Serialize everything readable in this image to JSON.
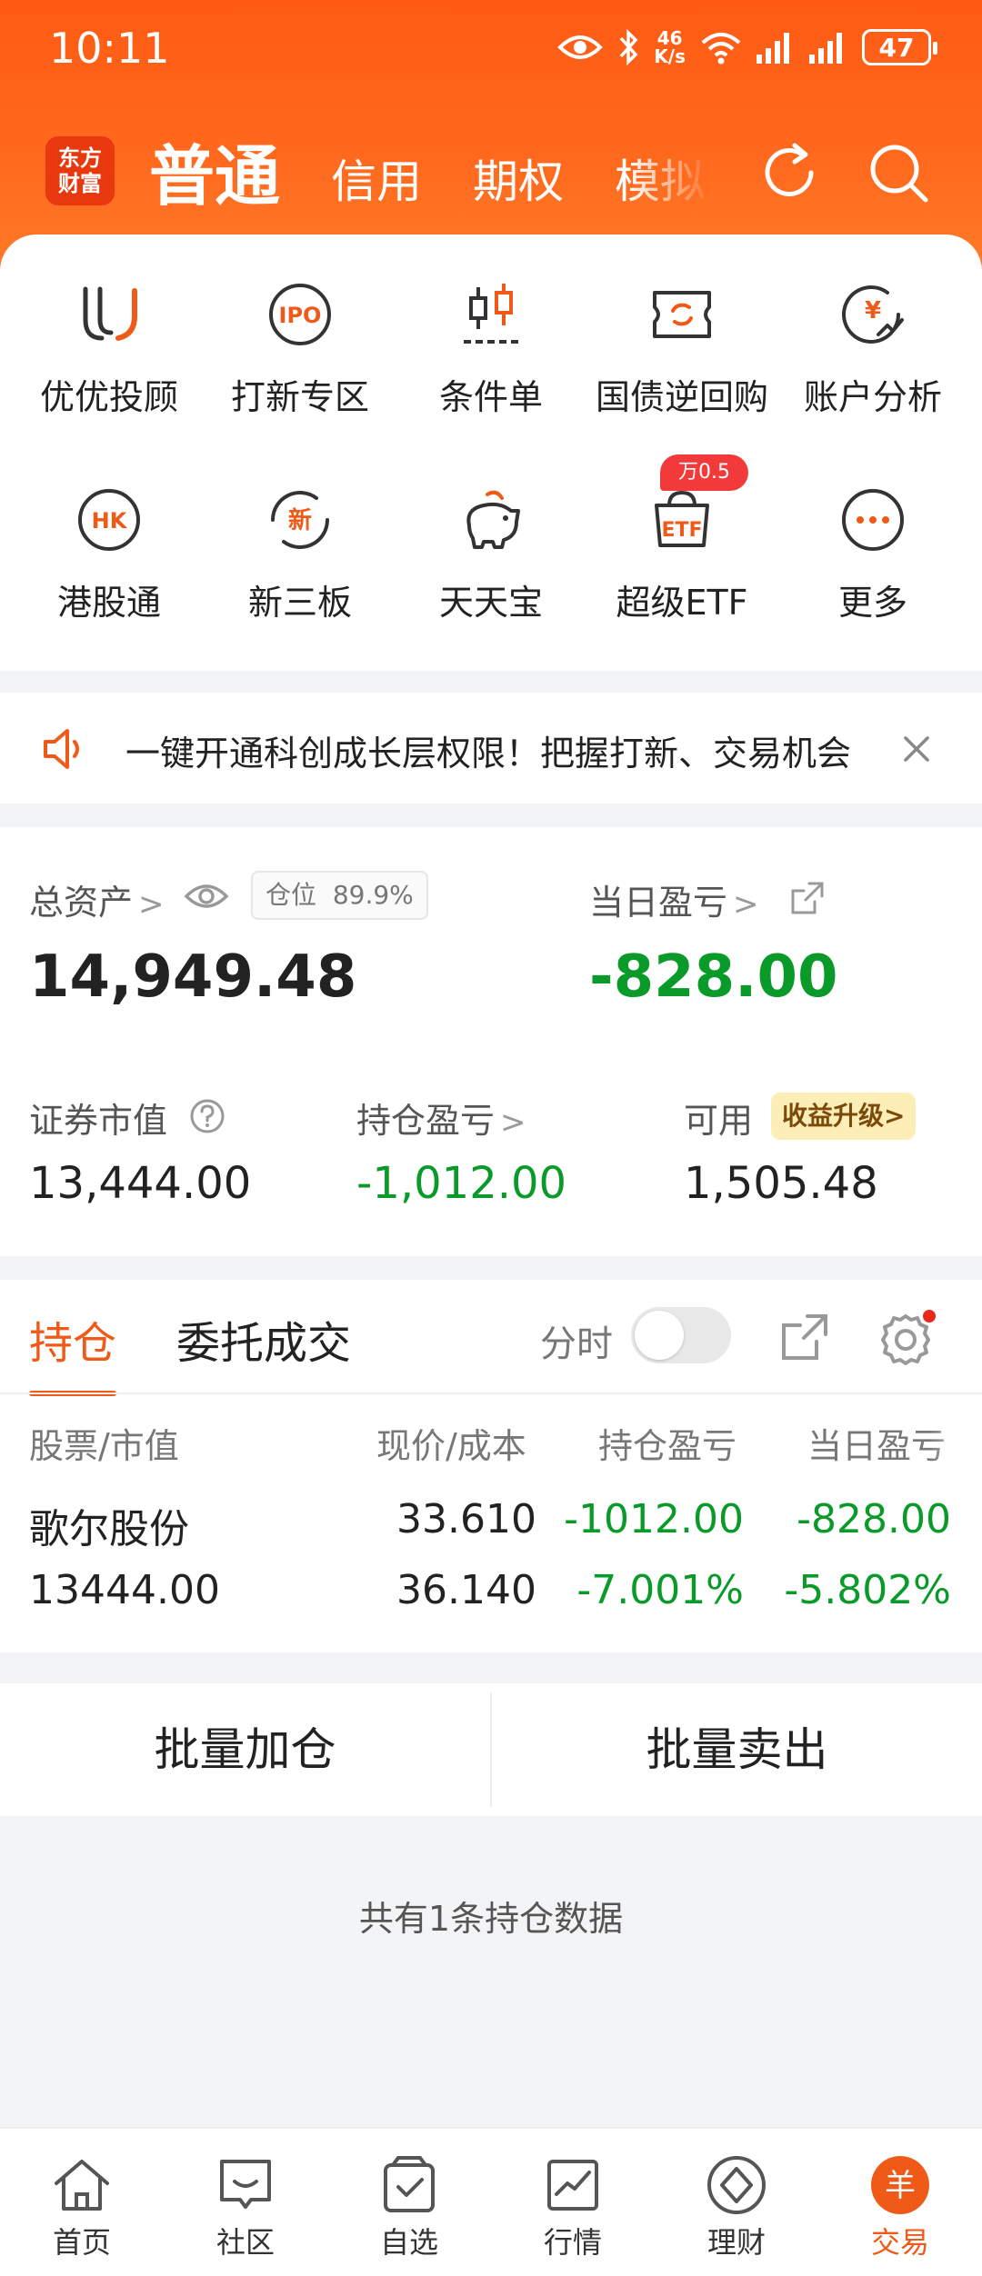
{
  "status_bar": {
    "time": "10:11",
    "net_speed_value": "46",
    "net_speed_unit": "K/s",
    "battery": "47"
  },
  "header": {
    "logo_line1": "东方",
    "logo_line2": "财富",
    "tabs": [
      {
        "label": "普通",
        "active": true
      },
      {
        "label": "信用",
        "active": false
      },
      {
        "label": "期权",
        "active": false
      },
      {
        "label": "模拟",
        "active": false
      }
    ]
  },
  "grid": {
    "items": [
      {
        "label": "优优投顾",
        "icon": "uu-advisor-icon"
      },
      {
        "label": "打新专区",
        "icon": "ipo-icon"
      },
      {
        "label": "条件单",
        "icon": "candlestick-icon"
      },
      {
        "label": "国债逆回购",
        "icon": "treasury-repo-icon"
      },
      {
        "label": "账户分析",
        "icon": "account-analysis-icon"
      },
      {
        "label": "港股通",
        "icon": "hk-icon"
      },
      {
        "label": "新三板",
        "icon": "neeq-icon"
      },
      {
        "label": "天天宝",
        "icon": "piggy-bank-icon"
      },
      {
        "label": "超级ETF",
        "icon": "etf-icon"
      },
      {
        "label": "更多",
        "icon": "more-icon"
      }
    ],
    "etf_badge": "万0.5"
  },
  "notice": {
    "text": "一键开通科创成长层权限！把握打新、交易机会"
  },
  "assets": {
    "total_label": "总资产",
    "position_label": "仓位",
    "position_value": "89.9%",
    "total_value": "14,949.48",
    "daily_pl_label": "当日盈亏",
    "daily_pl_value": "-828.00",
    "market_value_label": "证券市值",
    "market_value": "13,444.00",
    "holding_pl_label": "持仓盈亏",
    "holding_pl_value": "-1,012.00",
    "available_label": "可用",
    "available_value": "1,505.48",
    "upgrade_label": "收益升级>"
  },
  "holdings": {
    "tab_positions": "持仓",
    "tab_orders": "委托成交",
    "intraday_label": "分时",
    "columns": [
      "股票/市值",
      "现价/成本",
      "持仓盈亏",
      "当日盈亏"
    ],
    "rows": [
      {
        "name": "歌尔股份",
        "market_value": "13444.00",
        "price": "33.610",
        "cost": "36.140",
        "holding_pl": "-1012.00",
        "holding_pl_pct": "-7.001%",
        "daily_pl": "-828.00",
        "daily_pl_pct": "-5.802%"
      }
    ]
  },
  "actions": {
    "batch_add": "批量加仓",
    "batch_sell": "批量卖出"
  },
  "footer_note": "共有1条持仓数据",
  "bottom_nav": [
    {
      "label": "首页",
      "icon": "home-icon"
    },
    {
      "label": "社区",
      "icon": "community-icon"
    },
    {
      "label": "自选",
      "icon": "watchlist-icon"
    },
    {
      "label": "行情",
      "icon": "market-chart-icon"
    },
    {
      "label": "理财",
      "icon": "wealth-icon"
    },
    {
      "label": "交易",
      "icon": "trade-icon",
      "active": true
    }
  ],
  "colors": {
    "brand": "#ff5a14",
    "accent": "#f05a18",
    "loss_green": "#0a9a2a",
    "badge_red": "#f23a3a"
  }
}
